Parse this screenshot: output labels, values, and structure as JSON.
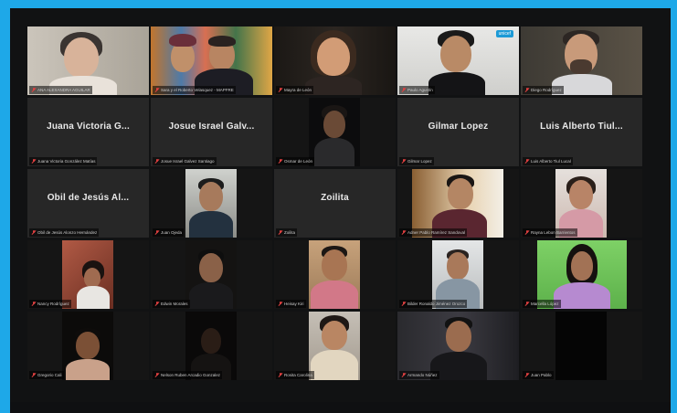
{
  "meeting": {
    "participants": [
      {
        "label": "ANA ALEXANDRA AGUILAR",
        "display": "",
        "video": true
      },
      {
        "label": "Sara y el Roberto Velasquez - MAPFRE",
        "display": "",
        "video": true
      },
      {
        "label": "Mayra de León",
        "display": "",
        "video": true
      },
      {
        "label": "Paulo Agustín",
        "display": "",
        "video": true
      },
      {
        "label": "Diego Rodríguez",
        "display": "",
        "video": true
      },
      {
        "label": "Juana Victoria González Matías",
        "display": "Juana Victoria G...",
        "video": false
      },
      {
        "label": "Josue Israel Galvez Santiago",
        "display": "Josue Israel Galv...",
        "video": false
      },
      {
        "label": "Osmar de León",
        "display": "",
        "video": true
      },
      {
        "label": "Gilmar Lopez",
        "display": "Gilmar Lopez",
        "video": false
      },
      {
        "label": "Luis Alberto Tiul Lucal",
        "display": "Luis Alberto Tiul...",
        "video": false
      },
      {
        "label": "Obil de Jesús Alonzo Hernández",
        "display": "Obil de Jesús Al...",
        "video": false
      },
      {
        "label": "Juan Ojeda",
        "display": "",
        "video": true
      },
      {
        "label": "Zoilita",
        "display": "Zoilita",
        "video": false
      },
      {
        "label": "Adner Pablo Ramírez Sandoval",
        "display": "",
        "video": true
      },
      {
        "label": "Rayna Lebon Barrientos",
        "display": "",
        "video": true
      },
      {
        "label": "Nancy Rodríguez",
        "display": "",
        "video": true
      },
      {
        "label": "Edwin Morales",
        "display": "",
        "video": true
      },
      {
        "label": "Heisay Kiri",
        "display": "",
        "video": true
      },
      {
        "label": "Bilder Ronaldo Jiménez Orozco",
        "display": "",
        "video": true
      },
      {
        "label": "Marcella López",
        "display": "",
        "video": true
      },
      {
        "label": "Gregorio Cali",
        "display": "",
        "video": true
      },
      {
        "label": "Nelson Ruben Arcadio Gonzalez",
        "display": "",
        "video": true
      },
      {
        "label": "Rosita Carolina",
        "display": "",
        "video": true
      },
      {
        "label": "Armando Núñez",
        "display": "",
        "video": true
      },
      {
        "label": "Juan Pablo",
        "display": "",
        "video": true
      }
    ],
    "badge": "unicef"
  },
  "colors": {
    "accent": "#1ea8e8",
    "window_bg": "#111213",
    "tile_bg": "#272727",
    "active_speaker": "#e8d23a",
    "muted": "#e04040"
  }
}
